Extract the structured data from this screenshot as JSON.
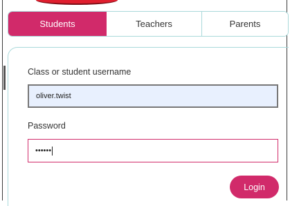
{
  "tabs": [
    {
      "label": "Students",
      "active": true
    },
    {
      "label": "Teachers",
      "active": false
    },
    {
      "label": "Parents",
      "active": false
    }
  ],
  "form": {
    "username_label": "Class or student username",
    "username_value": "oliver.twist",
    "password_label": "Password",
    "password_masked": "••••••",
    "login_label": "Login"
  },
  "colors": {
    "accent": "#d12a6a",
    "tab_border": "#a9d9da",
    "autofill_bg": "#e8f0fe",
    "top_accent": "#e01e2e"
  }
}
